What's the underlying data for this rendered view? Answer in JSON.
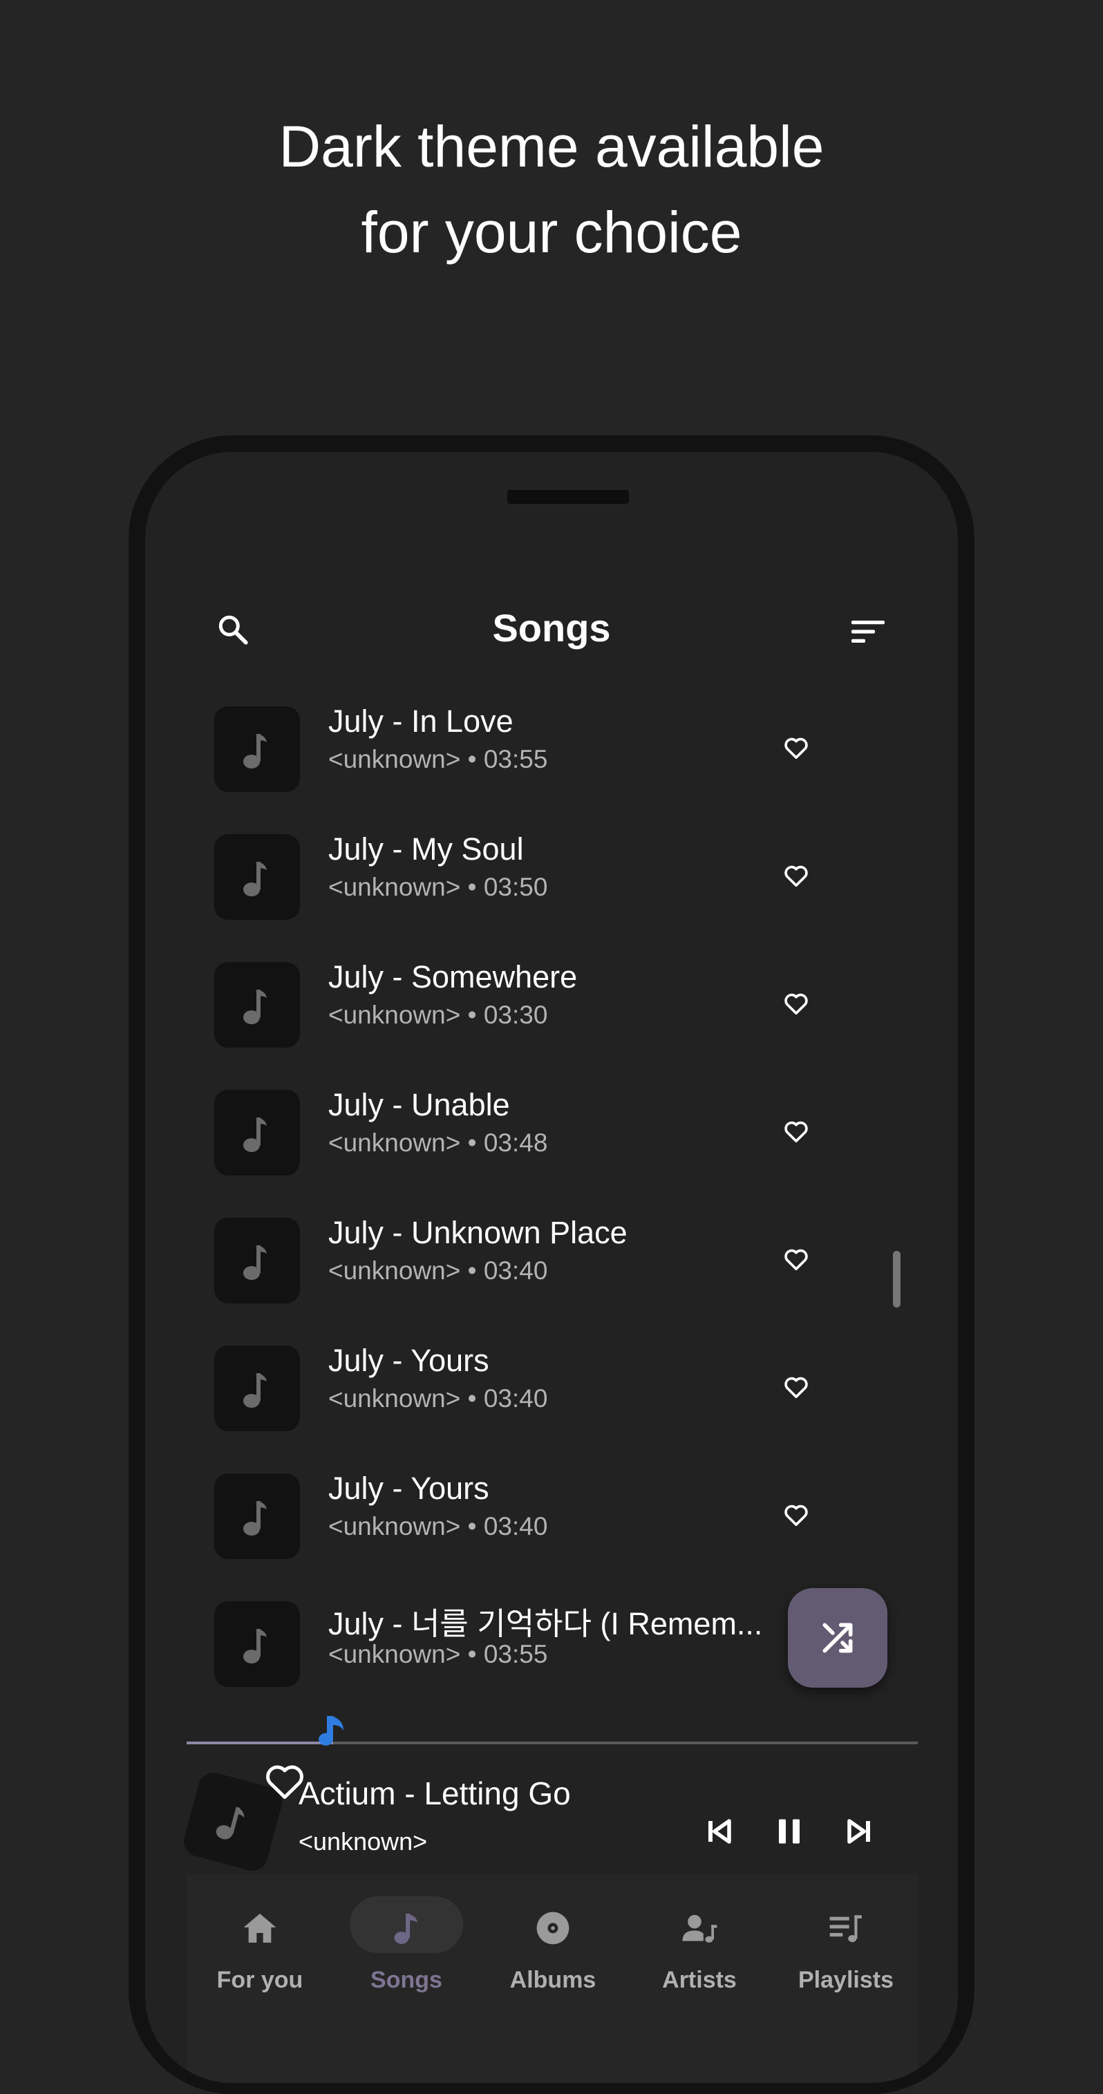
{
  "headline": {
    "line1": "Dark theme available",
    "line2": "for your choice"
  },
  "topbar": {
    "title": "Songs",
    "search_icon": "search-icon",
    "sort_icon": "sort-icon"
  },
  "songs": [
    {
      "title": "July - In Love",
      "meta": "<unknown> • 03:55"
    },
    {
      "title": "July - My Soul",
      "meta": "<unknown> • 03:50"
    },
    {
      "title": "July - Somewhere",
      "meta": "<unknown> • 03:30"
    },
    {
      "title": "July - Unable",
      "meta": "<unknown> • 03:48"
    },
    {
      "title": "July - Unknown Place",
      "meta": "<unknown> • 03:40"
    },
    {
      "title": "July - Yours",
      "meta": "<unknown> • 03:40"
    },
    {
      "title": "July - Yours",
      "meta": "<unknown> • 03:40"
    },
    {
      "title": "July - 너를 기억하다 (I Remem...",
      "meta": "<unknown> • 03:55"
    }
  ],
  "now_playing": {
    "title": "Actium - Letting Go",
    "artist": "<unknown>",
    "progress": 0.2
  },
  "nav": {
    "items": [
      {
        "label": "For you",
        "icon": "home-icon"
      },
      {
        "label": "Songs",
        "icon": "music-note-icon",
        "active": true
      },
      {
        "label": "Albums",
        "icon": "album-icon"
      },
      {
        "label": "Artists",
        "icon": "artist-icon"
      },
      {
        "label": "Playlists",
        "icon": "playlist-icon"
      }
    ]
  },
  "colors": {
    "background": "#252525",
    "screen": "#222222",
    "fab": "#625b71",
    "accent": "#8f87a8",
    "active_label": "#7d7591",
    "progress_note": "#2f7de0"
  }
}
